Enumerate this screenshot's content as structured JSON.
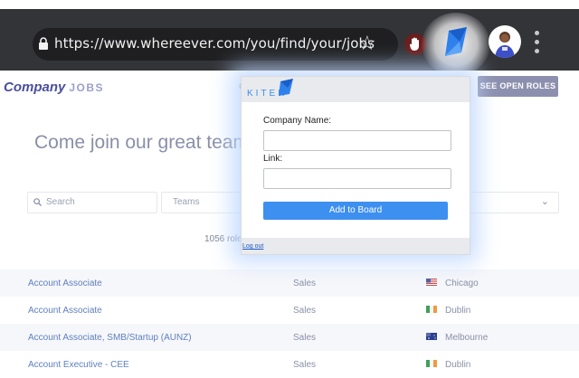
{
  "browser": {
    "url": "https://www.whereever.com/you/find/your/jobs",
    "star_glyph": "☆"
  },
  "page": {
    "brand": "Company",
    "brand_suffix": "JOBS",
    "partial_hidden_text": "C",
    "see_roles_label": "SEE OPEN ROLES",
    "headline": "Come join our great team",
    "filters": {
      "search_placeholder": "Search",
      "teams_label": "Teams",
      "location_chevron": "⌄"
    },
    "count_text": "1056 role",
    "rows": [
      {
        "title": "Account Associate",
        "team": "Sales",
        "flag": "us",
        "city": "Chicago"
      },
      {
        "title": "Account Associate",
        "team": "Sales",
        "flag": "ie",
        "city": "Dublin"
      },
      {
        "title": "Account Associate, SMB/Startup (AUNZ)",
        "team": "Sales",
        "flag": "au",
        "city": "Melbourne"
      },
      {
        "title": "Account Executive - CEE",
        "team": "Sales",
        "flag": "ie",
        "city": "Dublin"
      }
    ]
  },
  "popup": {
    "logo_text": "KITER",
    "company_label": "Company Name:",
    "company_value": "",
    "link_label": "Link:",
    "link_value": "",
    "add_button": "Add to Board",
    "logout": "Log out"
  },
  "colors": {
    "toolbar": "#333438",
    "accent": "#3d8ff0",
    "brand": "#4a4f9c",
    "link": "#5e7fc0"
  }
}
